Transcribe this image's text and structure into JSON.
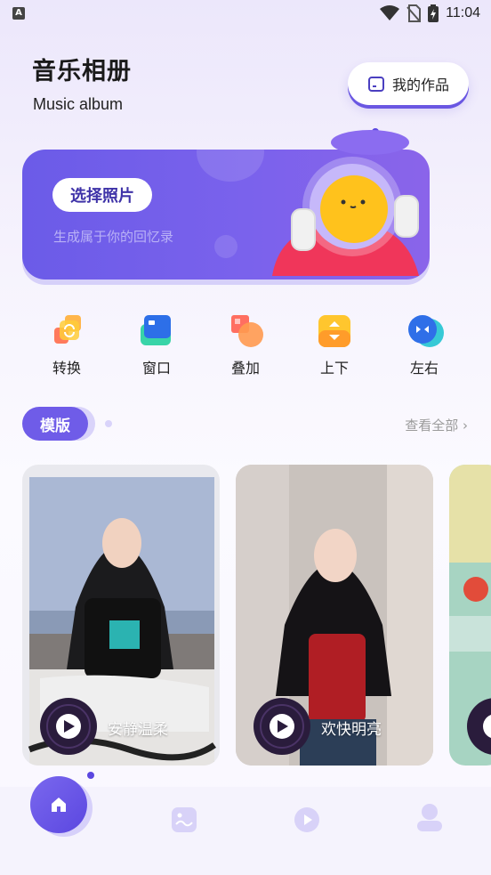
{
  "status_bar": {
    "time": "11:04",
    "notification_letter": "A"
  },
  "header": {
    "title": "音乐相册",
    "subtitle": "Music album",
    "my_works_label": "我的作品"
  },
  "banner": {
    "button_label": "选择照片",
    "subtitle": "生成属于你的回忆录"
  },
  "features": [
    {
      "label": "转换",
      "icon": "convert-icon"
    },
    {
      "label": "窗口",
      "icon": "window-icon"
    },
    {
      "label": "叠加",
      "icon": "overlay-icon"
    },
    {
      "label": "上下",
      "icon": "up-down-icon"
    },
    {
      "label": "左右",
      "icon": "left-right-icon"
    }
  ],
  "templates": {
    "tab_label": "模版",
    "view_all": "查看全部 ›",
    "cards": [
      {
        "title": "安静温柔"
      },
      {
        "title": "欢快明亮"
      },
      {
        "title": ""
      }
    ]
  },
  "bottom_nav": {
    "items": [
      {
        "icon": "home-icon"
      },
      {
        "icon": "gallery-icon"
      },
      {
        "icon": "video-icon"
      },
      {
        "icon": "profile-icon"
      }
    ]
  },
  "colors": {
    "accent": "#6b5be8",
    "accent_dark": "#5b47e0"
  }
}
